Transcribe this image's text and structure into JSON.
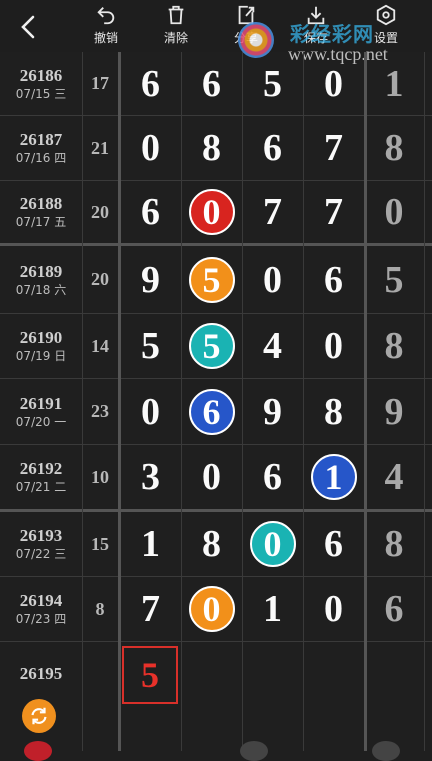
{
  "toolbar": {
    "back_label": "",
    "buttons": [
      {
        "label": "撤销",
        "icon": "undo-icon"
      },
      {
        "label": "清除",
        "icon": "trash-icon"
      },
      {
        "label": "分享",
        "icon": "share-icon"
      },
      {
        "label": "保存",
        "icon": "download-icon"
      },
      {
        "label": "设置",
        "icon": "gear-icon"
      }
    ]
  },
  "watermark": {
    "title": "彩经彩网",
    "url": "www.tqcp.net"
  },
  "colors": {
    "red": "#d8241f",
    "orange": "#f2901a",
    "teal": "#1ab3b3",
    "blue": "#2656c9"
  },
  "rows": [
    {
      "issue": "26186",
      "date": "07/15 三",
      "sum": "17",
      "digits": [
        "6",
        "6",
        "5",
        "0"
      ],
      "balls": [
        null,
        null,
        null,
        null
      ],
      "last": "1"
    },
    {
      "issue": "26187",
      "date": "07/16 四",
      "sum": "21",
      "digits": [
        "0",
        "8",
        "6",
        "7"
      ],
      "balls": [
        null,
        null,
        null,
        null
      ],
      "last": "8"
    },
    {
      "issue": "26188",
      "date": "07/17 五",
      "sum": "20",
      "digits": [
        "6",
        "0",
        "7",
        "7"
      ],
      "balls": [
        null,
        "red",
        null,
        null
      ],
      "last": "0"
    },
    {
      "issue": "26189",
      "date": "07/18 六",
      "sum": "20",
      "digits": [
        "9",
        "5",
        "0",
        "6"
      ],
      "balls": [
        null,
        "orange",
        null,
        null
      ],
      "last": "5"
    },
    {
      "issue": "26190",
      "date": "07/19 日",
      "sum": "14",
      "digits": [
        "5",
        "5",
        "4",
        "0"
      ],
      "balls": [
        null,
        "teal",
        null,
        null
      ],
      "last": "8"
    },
    {
      "issue": "26191",
      "date": "07/20 一",
      "sum": "23",
      "digits": [
        "0",
        "6",
        "9",
        "8"
      ],
      "balls": [
        null,
        "blue",
        null,
        null
      ],
      "last": "9"
    },
    {
      "issue": "26192",
      "date": "07/21 二",
      "sum": "10",
      "digits": [
        "3",
        "0",
        "6",
        "1"
      ],
      "balls": [
        null,
        null,
        null,
        "blue"
      ],
      "last": "4"
    },
    {
      "issue": "26193",
      "date": "07/22 三",
      "sum": "15",
      "digits": [
        "1",
        "8",
        "0",
        "6"
      ],
      "balls": [
        null,
        null,
        "teal",
        null
      ],
      "last": "8"
    },
    {
      "issue": "26194",
      "date": "07/23 四",
      "sum": "8",
      "digits": [
        "7",
        "0",
        "1",
        "0"
      ],
      "balls": [
        null,
        "orange",
        null,
        null
      ],
      "last": "6"
    }
  ],
  "next_row": {
    "issue": "26195",
    "prediction": "5"
  }
}
